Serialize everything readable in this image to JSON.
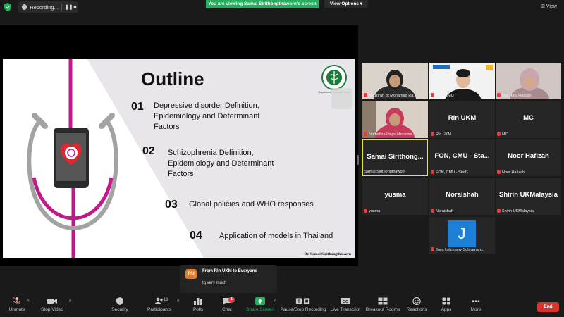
{
  "topbar": {
    "recording_label": "Recording...",
    "viewing_banner": "You are viewing Samai Sirithongthaworn's screen",
    "view_options": "View Options",
    "view_label": "View"
  },
  "slide": {
    "title": "Outline",
    "emblem_caption": "Department of Mental Health",
    "items": [
      {
        "num": "01",
        "text": "Depressive disorder Definition, Epidemiology and Determinant Factors"
      },
      {
        "num": "02",
        "text": "Schizophrenia Definition, Epidemiology and Determinant Factors"
      },
      {
        "num": "03",
        "text": "Global policies and WHO responses"
      },
      {
        "num": "04",
        "text": "Application of models in Thailand"
      }
    ],
    "author": "Dr. Samai Sirithongthaworn"
  },
  "participants": [
    {
      "name": "",
      "label": "Nadzirah Bt Mohamad Ra..."
    },
    {
      "name": "",
      "label": "FON CMU"
    },
    {
      "name": "",
      "label": "Nor Haty Hassan"
    },
    {
      "name": "",
      "label": "Norhafiza Idayu Mohama..."
    },
    {
      "name": "Rin UKM",
      "label": "Rin UKM"
    },
    {
      "name": "MC",
      "label": "MC"
    },
    {
      "name": "Samai  Sirithong...",
      "label": "Samai Sirithongthaworn"
    },
    {
      "name": "FON, CMU - Sta...",
      "label": "FON, CMU - Staff1"
    },
    {
      "name": "Noor Hafizah",
      "label": "Noor Hafizah"
    },
    {
      "name": "yusma",
      "label": "yusma"
    },
    {
      "name": "Noraishah",
      "label": "Noraishah"
    },
    {
      "name": "Shirin UKMalaysia",
      "label": "Shirin UKMalaysia"
    },
    {
      "name": "J",
      "label": "Jaya Letchumy Subraman..."
    }
  ],
  "chat_toast": {
    "avatar": "RU",
    "from": "From Rin UKM to Everyone",
    "message": "tq very much"
  },
  "toolbar": {
    "unmute": "Unmute",
    "stop_video": "Stop Video",
    "security": "Security",
    "participants": "Participants",
    "participants_count": "13",
    "polls": "Polls",
    "chat": "Chat",
    "chat_badge": "1",
    "share_screen": "Share Screen",
    "pause_recording": "Pause/Stop Recording",
    "live_transcript": "Live Transcript",
    "breakout_rooms": "Breakout Rooms",
    "reactions": "Reactions",
    "apps": "Apps",
    "more": "More",
    "end": "End"
  },
  "colors": {
    "viewing_banner": "#27ae60",
    "end_button": "#d9342b",
    "active_speaker_border": "#e6e24a",
    "stethoscope": "#c2188a"
  }
}
